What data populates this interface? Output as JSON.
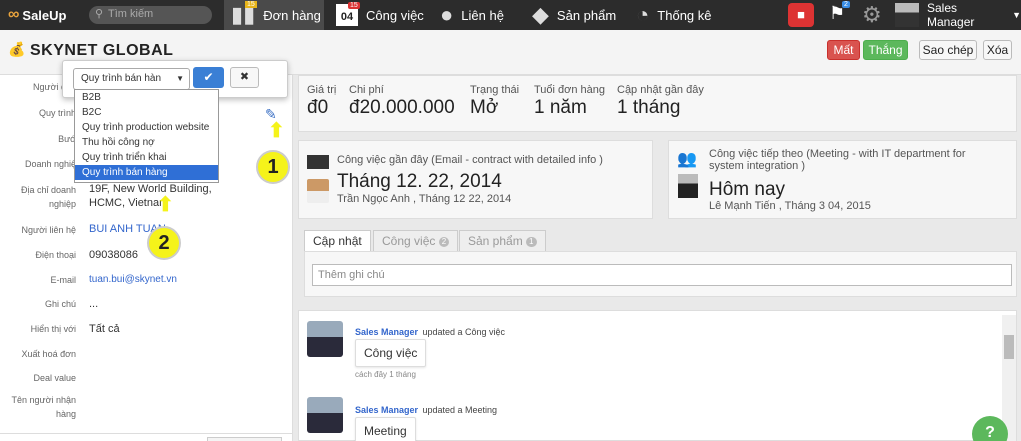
{
  "nav": {
    "logo": "SaleUp",
    "search_placeholder": "Tìm kiếm",
    "items": [
      {
        "label": "Đơn hàng",
        "icon": "orders-icon"
      },
      {
        "label": "Công việc",
        "icon": "calendar-icon"
      },
      {
        "label": "Liên hệ",
        "icon": "contact-icon"
      },
      {
        "label": "Sản phẩm",
        "icon": "product-icon"
      },
      {
        "label": "Thống kê",
        "icon": "gauge-icon"
      }
    ],
    "calendar_day": "04",
    "calendar_badge": "15",
    "orders_badge": "15",
    "flag_badge": "2",
    "user": "Sales Manager"
  },
  "header": {
    "title": "SKYNET GLOBAL",
    "lose": "Mất",
    "win": "Thắng",
    "copy": "Sao chép",
    "delete": "Xóa"
  },
  "form": {
    "labels": [
      "Người quả",
      "Quy trình",
      "Bướ",
      "Doanh nghiệ",
      "Địa chỉ doanh nghiệp",
      "Người liên hệ",
      "Điện thoại",
      "E-mail",
      "Ghi chú",
      "Hiển thị với",
      "Xuất hoá đơn",
      "Deal value",
      "Tên người nhận hàng"
    ],
    "address": "19F, New World Building, HCMC, Vietnam",
    "contact": "BUI ANH TUAN",
    "phone": "09038086",
    "email": "tuan.bui@skynet.vn",
    "note": "...",
    "visible": "Tất cả"
  },
  "dropdown": {
    "selected": "Quy trình bán hàn",
    "options": [
      "B2B",
      "B2C",
      "Quy trình production website",
      "Thu hồi công nợ",
      "Quy trình triển khai",
      "Quy trình bán hàng"
    ],
    "highlight_index": 5
  },
  "callouts": [
    "1",
    "2"
  ],
  "stats": [
    {
      "label": "Giá trị",
      "value": "đ0"
    },
    {
      "label": "Chi phí",
      "value": "đ20.000.000"
    },
    {
      "label": "Trạng thái",
      "value": "Mở"
    },
    {
      "label": "Tuổi đơn hàng",
      "value": "1 năm"
    },
    {
      "label": "Cập nhật gần đây",
      "value": "1 tháng"
    }
  ],
  "recent": {
    "title": "Công việc gần đây (Email - contract with detailed info )",
    "date": "Tháng 12. 22, 2014",
    "by": "Trần Ngọc Anh , Tháng 12 22, 2014"
  },
  "next": {
    "title": "Công việc tiếp theo (Meeting - with IT department for system integration )",
    "date": "Hôm nay",
    "by": "Lê Mạnh Tiến , Tháng 3 04, 2015"
  },
  "tabs": [
    {
      "label": "Cập nhật"
    },
    {
      "label": "Công việc",
      "badge": "2"
    },
    {
      "label": "Sản phẩm",
      "badge": "1"
    }
  ],
  "note_placeholder": "Thêm ghi chú",
  "feed": [
    {
      "author": "Sales Manager",
      "action": "updated a Công việc",
      "bubble": "Công việc",
      "time": "cách đây 1 tháng"
    },
    {
      "author": "Sales Manager",
      "action": "updated a Meeting",
      "bubble": "Meeting"
    }
  ]
}
